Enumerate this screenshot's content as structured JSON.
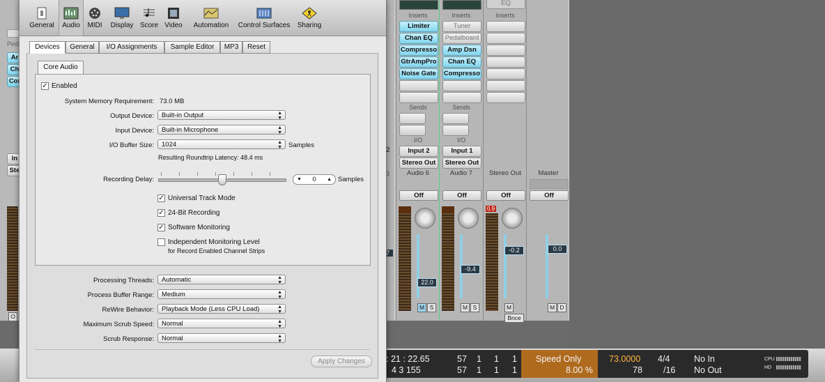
{
  "mixer": {
    "left_strip": {
      "items": [
        "Ar",
        "Ch",
        "Cor",
        "Pedi",
        "In",
        "Ste",
        "O"
      ]
    },
    "strips": [
      {
        "inserts_label": "Inserts",
        "inserts": [
          "Limiter",
          "Chan EQ",
          "Compresso",
          "GtrAmpPro",
          "Noise Gate"
        ],
        "sends_label": "Sends",
        "io_label": "I/O",
        "input": "Input 2",
        "output": "Stereo Out",
        "name": "Audio 6",
        "auto": "Off",
        "fader": "22.0"
      },
      {
        "inserts_label": "Inserts",
        "inserts": [
          "Tuner",
          "Pedalboard",
          "Amp Dsn",
          "Chan EQ",
          "Compresso"
        ],
        "sends_label": "Sends",
        "io_label": "I/O",
        "input": "Input 1",
        "output": "Stereo Out",
        "name": "Audio 7",
        "auto": "Off",
        "fader": "-9.4"
      },
      {
        "eq_label": "EQ",
        "inserts_label": "Inserts",
        "name": "Stereo Out",
        "auto": "Off",
        "fader": "-0.2",
        "peak": "0.9",
        "bottom": "Bnce"
      },
      {
        "name": "Master",
        "auto": "Off",
        "fader": "0.0"
      }
    ],
    "partial_labels": {
      "r1": "2",
      "r2": "3",
      "r3": "7"
    }
  },
  "transport": {
    "smpte_top": ": 21 : 22.65",
    "smpte_bot": "4    3  155",
    "bars_top": [
      "57",
      "1",
      "1",
      "1"
    ],
    "bars_bot": [
      "57",
      "1",
      "1",
      "1"
    ],
    "mode": "Speed Only",
    "percent": "8.00 %",
    "tempo": "73.0000",
    "tempo_bot": "78",
    "sig_top": "4/4",
    "sig_bot": "/16",
    "in": "No In",
    "out": "No Out",
    "cpu": "CPU",
    "hd": "HD"
  },
  "prefs": {
    "toolbar": [
      "General",
      "Audio",
      "MIDI",
      "Display",
      "Score",
      "Video",
      "Automation",
      "Control Surfaces",
      "Sharing"
    ],
    "tabs": [
      "Devices",
      "General",
      "I/O Assignments",
      "Sample Editor",
      "MP3",
      "Reset"
    ],
    "subtab": "Core Audio",
    "enabled": "Enabled",
    "mem_label": "System Memory Requirement:",
    "mem_value": "73.0 MB",
    "output_label": "Output Device:",
    "output_value": "Built-in Output",
    "input_label": "Input Device:",
    "input_value": "Built-in Microphone",
    "buffer_label": "I/O Buffer Size:",
    "buffer_value": "1024",
    "buffer_unit": "Samples",
    "latency": "Resulting Roundtrip Latency: 48.4 ms",
    "delay_label": "Recording Delay:",
    "delay_value": "0",
    "delay_unit": "Samples",
    "checks": {
      "universal": "Universal Track Mode",
      "bit24": "24-Bit Recording",
      "software": "Software Monitoring",
      "independent": "Independent Monitoring Level",
      "independent_sub": "for Record Enabled Channel Strips"
    },
    "threads_label": "Processing Threads:",
    "threads_value": "Automatic",
    "range_label": "Process Buffer Range:",
    "range_value": "Medium",
    "rewire_label": "ReWire Behavior:",
    "rewire_value": "Playback Mode (Less CPU Load)",
    "scrub_speed_label": "Maximum Scrub Speed:",
    "scrub_speed_value": "Normal",
    "scrub_resp_label": "Scrub Response:",
    "scrub_resp_value": "Normal",
    "apply": "Apply Changes"
  }
}
